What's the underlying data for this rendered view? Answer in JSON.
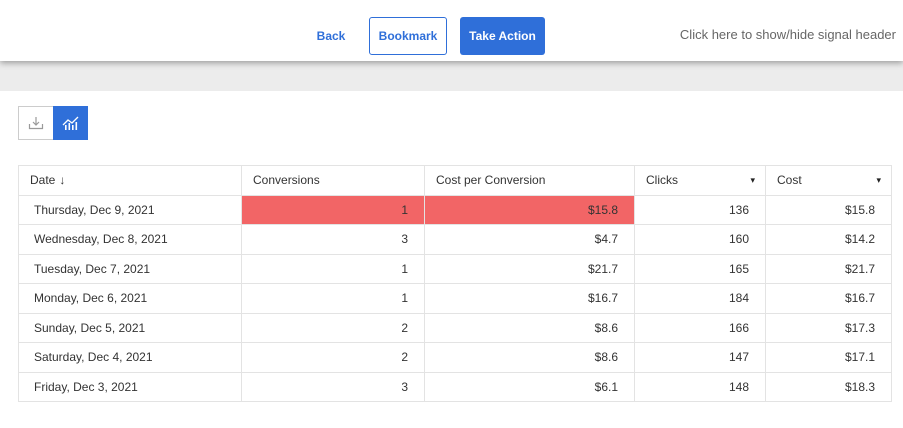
{
  "header": {
    "back_label": "Back",
    "bookmark_label": "Bookmark",
    "take_action_label": "Take Action",
    "toggle_label": "Click here to show/hide signal header"
  },
  "toolbar": {
    "icons": [
      "download-icon",
      "chart-icon"
    ]
  },
  "colors": {
    "accent": "#2f6fd9",
    "highlight": "#f26566"
  },
  "table": {
    "columns": [
      {
        "label": "Date",
        "sort_indicator": "↓"
      },
      {
        "label": "Conversions"
      },
      {
        "label": "Cost per Conversion"
      },
      {
        "label": "Clicks",
        "dropdown": "▾"
      },
      {
        "label": "Cost",
        "dropdown": "▾"
      }
    ],
    "rows": [
      {
        "date": "Thursday, Dec 9, 2021",
        "conversions": "1",
        "cost_per_conversion": "$15.8",
        "clicks": "136",
        "cost": "$15.8",
        "highlighted": true
      },
      {
        "date": "Wednesday, Dec 8, 2021",
        "conversions": "3",
        "cost_per_conversion": "$4.7",
        "clicks": "160",
        "cost": "$14.2"
      },
      {
        "date": "Tuesday, Dec 7, 2021",
        "conversions": "1",
        "cost_per_conversion": "$21.7",
        "clicks": "165",
        "cost": "$21.7"
      },
      {
        "date": "Monday, Dec 6, 2021",
        "conversions": "1",
        "cost_per_conversion": "$16.7",
        "clicks": "184",
        "cost": "$16.7"
      },
      {
        "date": "Sunday, Dec 5, 2021",
        "conversions": "2",
        "cost_per_conversion": "$8.6",
        "clicks": "166",
        "cost": "$17.3"
      },
      {
        "date": "Saturday, Dec 4, 2021",
        "conversions": "2",
        "cost_per_conversion": "$8.6",
        "clicks": "147",
        "cost": "$17.1"
      },
      {
        "date": "Friday, Dec 3, 2021",
        "conversions": "3",
        "cost_per_conversion": "$6.1",
        "clicks": "148",
        "cost": "$18.3"
      }
    ]
  }
}
